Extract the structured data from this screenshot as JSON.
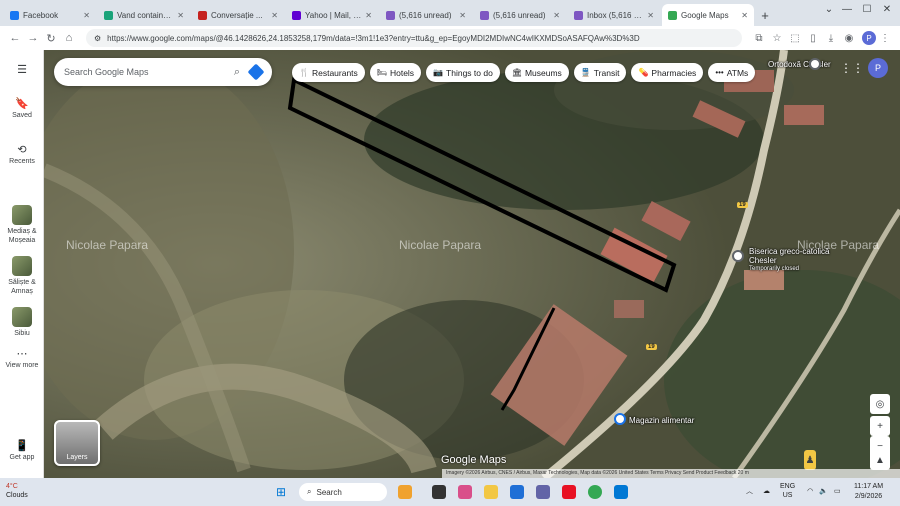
{
  "browser": {
    "tabs": [
      {
        "label": "Facebook",
        "color": "#1877f2",
        "active": false
      },
      {
        "label": "Vand containere ...",
        "color": "#1aa37a",
        "active": false
      },
      {
        "label": "Conversație ...",
        "color": "#c5221f",
        "active": false
      },
      {
        "label": "Yahoo | Mail, Ve...",
        "color": "#6001d2",
        "active": false
      },
      {
        "label": "(5,616 unread)",
        "color": "#7e57c2",
        "active": false
      },
      {
        "label": "(5,616 unread)",
        "color": "#7e57c2",
        "active": false
      },
      {
        "label": "Inbox (5,616 un...",
        "color": "#7e57c2",
        "active": false
      },
      {
        "label": "Google Maps",
        "color": "#34a853",
        "active": true
      }
    ],
    "new_tab": "+",
    "url": "https://www.google.com/maps/@46.1428626,24.1853258,179m/data=!3m1!1e3?entry=ttu&g_ep=EgoyMDI2MDIwNC4wIKXMDSoASAFQAw%3D%3D",
    "profile_initial": "P"
  },
  "sidebar": {
    "saved": "Saved",
    "recents": "Recents",
    "places": [
      "Mediaș & Moșeaia",
      "Săliște & Amnaș",
      "Sibiu"
    ],
    "view_more": "View more",
    "get_app": "Get app"
  },
  "search": {
    "placeholder": "Search Google Maps"
  },
  "chips": [
    {
      "icon": "restaurant-icon",
      "glyph": "🍴",
      "label": "Restaurants"
    },
    {
      "icon": "hotel-icon",
      "glyph": "🛏",
      "label": "Hotels"
    },
    {
      "icon": "camera-icon",
      "glyph": "📷",
      "label": "Things to do"
    },
    {
      "icon": "museum-icon",
      "glyph": "🏛",
      "label": "Museums"
    },
    {
      "icon": "transit-icon",
      "glyph": "🚆",
      "label": "Transit"
    },
    {
      "icon": "pharmacy-icon",
      "glyph": "💊",
      "label": "Pharmacies"
    },
    {
      "icon": "more-icon",
      "glyph": "•••",
      "label": "ATMs"
    }
  ],
  "map": {
    "watermark": "Nicolae Papara",
    "church_top": "Ortodoxă Chesler",
    "church_label": "Biserica greco-catolică Chesler",
    "church_status": "Temporarily closed",
    "shop_label": "Magazin alimentar",
    "road_number": "19",
    "layers_label": "Layers",
    "logo": "Google Maps",
    "attribution": "Imagery ©2026 Airbus, CNES / Airbus, Maxar Technologies, Map data ©2026   United States   Terms   Privacy   Send Product Feedback   20 m"
  },
  "taskbar": {
    "temperature": "4°C",
    "weather": "Clouds",
    "search_label": "Search",
    "language": "ENG",
    "region": "US",
    "time": "11:17 AM",
    "date": "2/9/2026"
  }
}
